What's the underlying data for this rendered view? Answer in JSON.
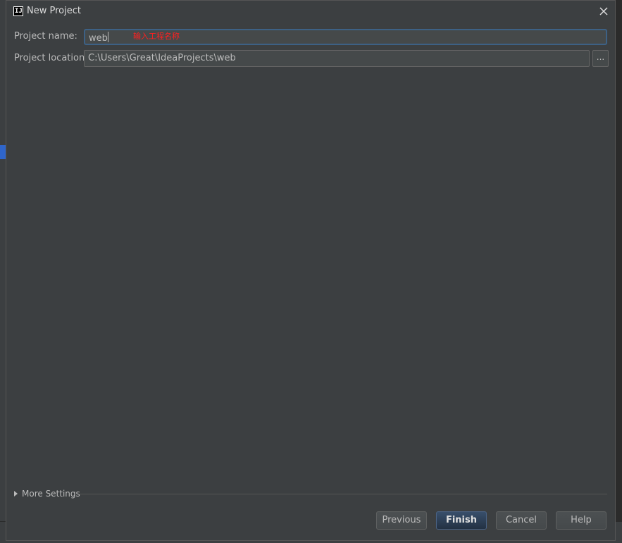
{
  "dialog": {
    "title": "New Project",
    "app_icon": "IJ",
    "close_icon": "close-icon"
  },
  "form": {
    "name_label": "Project name:",
    "name_value": "web",
    "name_annotation": "输入工程名称",
    "location_label": "Project location:",
    "location_value": "C:\\Users\\Great\\IdeaProjects\\web",
    "browse_label": "..."
  },
  "more_settings": {
    "label": "More Settings"
  },
  "buttons": {
    "previous": "Previous",
    "finish": "Finish",
    "cancel": "Cancel",
    "help": "Help"
  },
  "colors": {
    "background": "#3c3f41",
    "field": "#45494a",
    "focus_border": "#3d6185",
    "annotation": "#ff2020"
  }
}
